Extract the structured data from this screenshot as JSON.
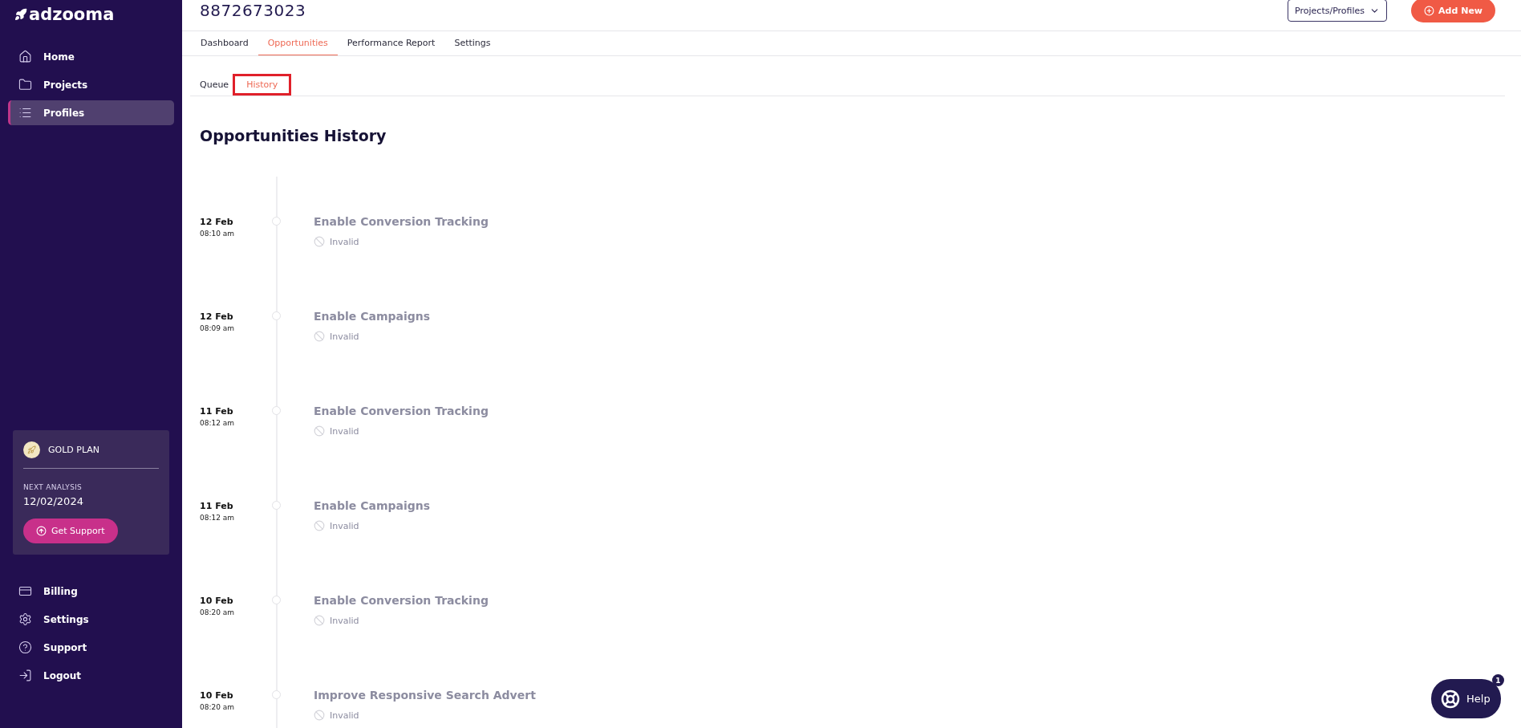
{
  "logo": "adzooma",
  "nav": [
    {
      "label": "Home",
      "selected": false
    },
    {
      "label": "Projects",
      "selected": false
    },
    {
      "label": "Profiles",
      "selected": true
    }
  ],
  "plan": {
    "name": "GOLD PLAN",
    "next_label": "NEXT ANALYSIS",
    "next_date": "12/02/2024",
    "button": "Get Support"
  },
  "bottom_nav": [
    {
      "label": "Billing"
    },
    {
      "label": "Settings"
    },
    {
      "label": "Support"
    },
    {
      "label": "Logout"
    }
  ],
  "header": {
    "title": "8872673023",
    "dropdown": "Projects/Profiles",
    "add_button": "Add New"
  },
  "tabs": [
    {
      "label": "Dashboard",
      "selected": false
    },
    {
      "label": "Opportunities",
      "selected": true
    },
    {
      "label": "Performance Report",
      "selected": false
    },
    {
      "label": "Settings",
      "selected": false
    }
  ],
  "subtabs": [
    {
      "label": "Queue",
      "selected": false,
      "highlighted": false
    },
    {
      "label": "History",
      "selected": true,
      "highlighted": true
    }
  ],
  "heading": "Opportunities History",
  "history": [
    {
      "date": "12 Feb",
      "time": "08:10 am",
      "title": "Enable Conversion Tracking",
      "status": "Invalid"
    },
    {
      "date": "12 Feb",
      "time": "08:09 am",
      "title": "Enable Campaigns",
      "status": "Invalid"
    },
    {
      "date": "11 Feb",
      "time": "08:12 am",
      "title": "Enable Conversion Tracking",
      "status": "Invalid"
    },
    {
      "date": "11 Feb",
      "time": "08:12 am",
      "title": "Enable Campaigns",
      "status": "Invalid"
    },
    {
      "date": "10 Feb",
      "time": "08:20 am",
      "title": "Enable Conversion Tracking",
      "status": "Invalid"
    },
    {
      "date": "10 Feb",
      "time": "08:20 am",
      "title": "Improve Responsive Search Advert",
      "status": "Invalid"
    }
  ],
  "help": {
    "label": "Help",
    "badge": "1"
  }
}
